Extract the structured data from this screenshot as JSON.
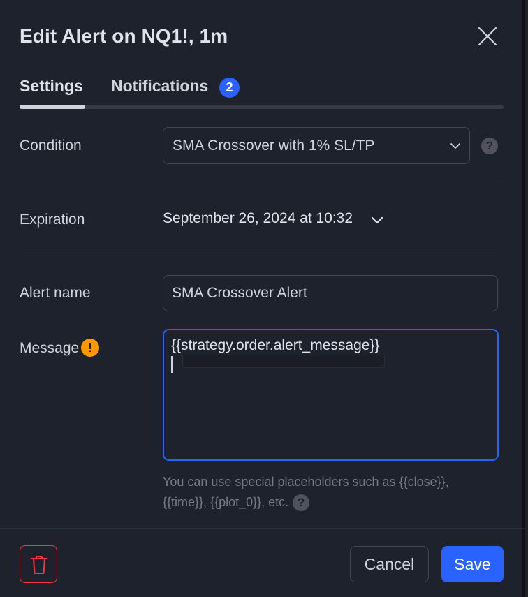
{
  "dialog": {
    "title": "Edit Alert on NQ1!, 1m",
    "close_icon": "close-icon"
  },
  "tabs": [
    {
      "label": "Settings",
      "active": true
    },
    {
      "label": "Notifications",
      "badge": "2"
    }
  ],
  "condition": {
    "label": "Condition",
    "value": "SMA Crossover with 1% SL/TP",
    "help": "?"
  },
  "expiration": {
    "label": "Expiration",
    "value": "September 26, 2024 at 10:32"
  },
  "alert_name": {
    "label": "Alert name",
    "value": "SMA Crossover Alert"
  },
  "message": {
    "label": "Message",
    "warning": "!",
    "value": "{{strategy.order.alert_message}}",
    "hint": "You can use special placeholders such as {{close}}, {{time}}, {{plot_0}}, etc.",
    "hint_help": "?"
  },
  "footer": {
    "delete_icon": "trash-icon",
    "cancel_label": "Cancel",
    "save_label": "Save"
  },
  "colors": {
    "background": "#1e222d",
    "accent": "#2962ff",
    "warning": "#ff9800",
    "danger": "#f23645",
    "text": "#d1d4dc",
    "muted": "#787b86"
  }
}
